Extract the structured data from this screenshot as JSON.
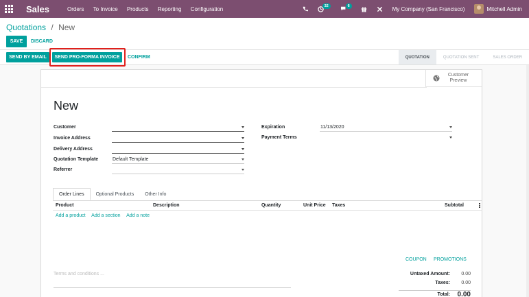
{
  "navbar": {
    "app_name": "Sales",
    "menu": [
      "Orders",
      "To Invoice",
      "Products",
      "Reporting",
      "Configuration"
    ],
    "activity_count": "32",
    "message_count": "6",
    "company": "My Company (San Francisco)",
    "user": "Mitchell Admin",
    "color": "#7c4e70"
  },
  "breadcrumb": {
    "parent": "Quotations",
    "separator": "/",
    "current": "New"
  },
  "buttons": {
    "save": "SAVE",
    "discard": "DISCARD",
    "send_email": "SEND BY EMAIL",
    "send_proforma": "SEND PRO-FORMA INVOICE",
    "confirm": "CONFIRM"
  },
  "stages": [
    "QUOTATION",
    "QUOTATION SENT",
    "SALES ORDER"
  ],
  "active_stage": "QUOTATION",
  "customer_preview": {
    "line1": "Customer",
    "line2": "Preview"
  },
  "form": {
    "title": "New",
    "customer": {
      "label": "Customer",
      "value": ""
    },
    "invoice_address": {
      "label": "Invoice Address",
      "value": ""
    },
    "delivery_address": {
      "label": "Delivery Address",
      "value": ""
    },
    "quotation_template": {
      "label": "Quotation Template",
      "value": "Default Template"
    },
    "referrer": {
      "label": "Referrer",
      "value": ""
    },
    "expiration": {
      "label": "Expiration",
      "value": "11/13/2020"
    },
    "payment_terms": {
      "label": "Payment Terms",
      "value": ""
    }
  },
  "tabs": [
    "Order Lines",
    "Optional Products",
    "Other Info"
  ],
  "columns": [
    "Product",
    "Description",
    "Quantity",
    "Unit Price",
    "Taxes",
    "Subtotal"
  ],
  "add_links": [
    "Add a product",
    "Add a section",
    "Add a note"
  ],
  "coupon": "COUPON",
  "promotions": "PROMOTIONS",
  "terms_placeholder": "Terms and conditions ...",
  "totals": {
    "untaxed_label": "Untaxed Amount:",
    "untaxed_value": "0.00",
    "taxes_label": "Taxes:",
    "taxes_value": "0.00",
    "total_label": "Total:",
    "total_value": "0.00"
  },
  "accent_color": "#00a09d",
  "highlight_color": "#e0201c"
}
